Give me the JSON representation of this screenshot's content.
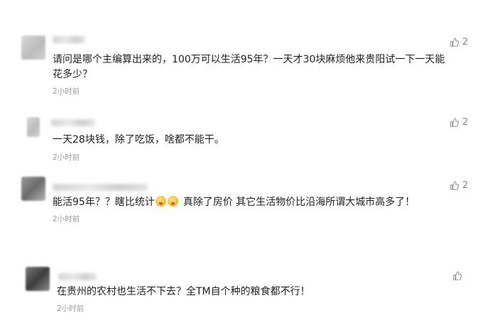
{
  "comments": [
    {
      "text_line1": "请问是哪个主编算出来的，100万可以生活95年？一天才30块麻烦他来贵阳试一下一天能",
      "text_line2": "花多少？",
      "time": "2小时前",
      "likes": "2"
    },
    {
      "text_line1": "一天28块钱，除了吃饭，啥都不能干。",
      "time": "2小时前",
      "likes": "2"
    },
    {
      "text_part1": "能活95年？？瞎比统计",
      "text_part2": "真除了房价 其它生活物价比沿海所谓大城市高多了！",
      "time": "2小时前",
      "likes": "2"
    },
    {
      "text_line1": "在贵州的农村也生活不下去？全TM自个种的粮食都不行！",
      "time": "2小时前",
      "likes": ""
    }
  ],
  "icons": {
    "like": "thumbs-up-icon",
    "emoji": "laughing-emoji-icon"
  },
  "colors": {
    "text": "#1f1f1f",
    "meta": "#9a9a9a",
    "like": "#8a8a8a"
  }
}
